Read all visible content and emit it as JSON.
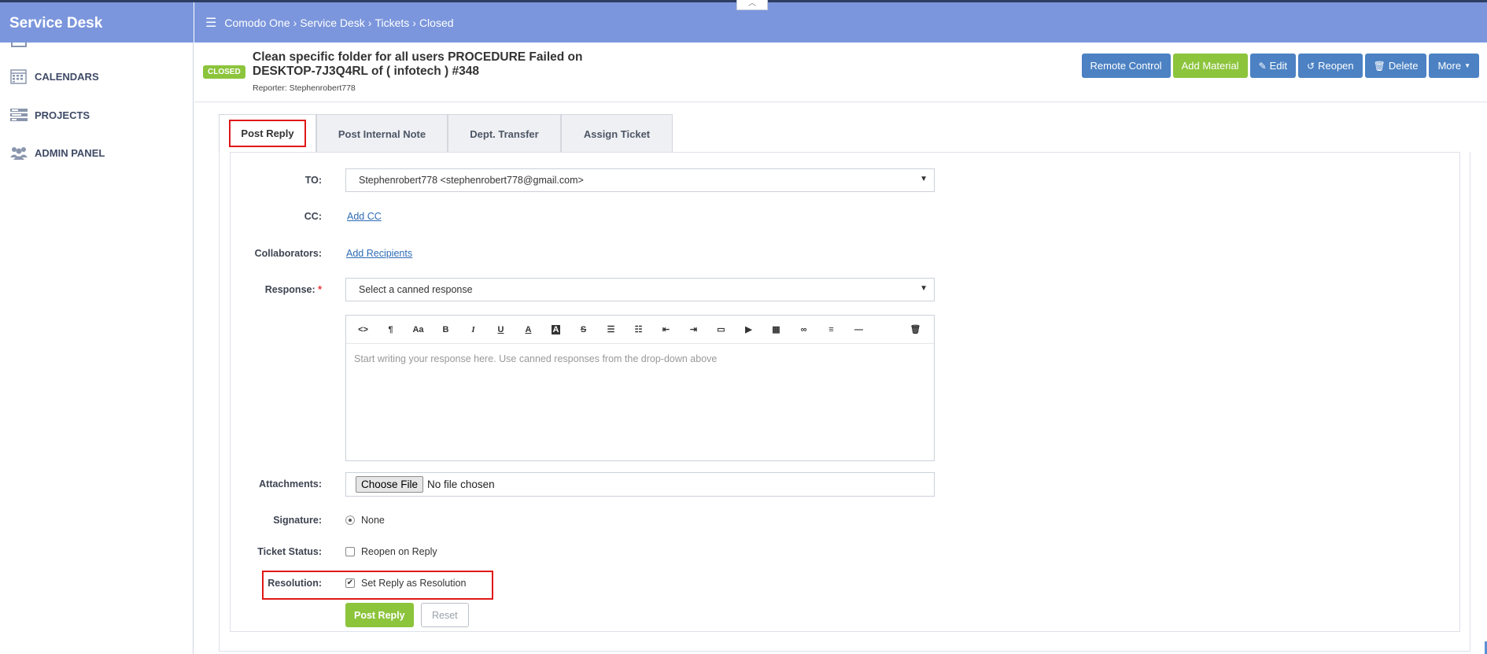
{
  "app": {
    "title": "Service Desk"
  },
  "breadcrumb": {
    "items": [
      "Comodo One",
      "Service Desk",
      "Tickets",
      "Closed"
    ]
  },
  "sidebar": {
    "items": [
      {
        "label": "CALENDARS",
        "icon": "calendar-icon"
      },
      {
        "label": "PROJECTS",
        "icon": "projects-icon"
      },
      {
        "label": "ADMIN PANEL",
        "icon": "users-icon"
      }
    ]
  },
  "ticket": {
    "status_badge": "CLOSED",
    "title": "Clean specific folder for all users PROCEDURE Failed on DESKTOP-7J3Q4RL of ( infotech ) #348",
    "reporter": "Reporter: Stephenrobert778"
  },
  "actions": {
    "remote_control": "Remote Control",
    "add_material": "Add Material",
    "edit": "Edit",
    "reopen": "Reopen",
    "delete": "Delete",
    "more": "More"
  },
  "tabs": [
    "Post Reply",
    "Post Internal Note",
    "Dept. Transfer",
    "Assign Ticket"
  ],
  "form": {
    "to_label": "TO:",
    "to_value": "Stephenrobert778 <stephenrobert778@gmail.com>",
    "cc_label": "CC:",
    "cc_link": "Add CC",
    "collab_label": "Collaborators:",
    "collab_link": "Add Recipients",
    "response_label": "Response:",
    "response_required": "*",
    "response_value": "Select a canned response",
    "editor_placeholder": "Start writing your response here. Use canned responses from the drop-down above",
    "attachments_label": "Attachments:",
    "file_button": "Choose File",
    "file_status": "No file chosen",
    "signature_label": "Signature:",
    "signature_value": "None",
    "status_label": "Ticket Status:",
    "status_option": "Reopen on Reply",
    "resolution_label": "Resolution:",
    "resolution_option": "Set Reply as Resolution",
    "submit": "Post Reply",
    "reset": "Reset"
  },
  "toolbar": [
    "<>",
    "¶",
    "Aa",
    "B",
    "I",
    "U",
    "A",
    "A",
    "S",
    "list",
    "olist",
    "outdent",
    "indent",
    "image",
    "video",
    "table",
    "link",
    "align",
    "—"
  ],
  "colors": {
    "header": "#7b96dc",
    "primary": "#4c82c3",
    "success": "#8cc43c",
    "highlight": "#e01818"
  }
}
